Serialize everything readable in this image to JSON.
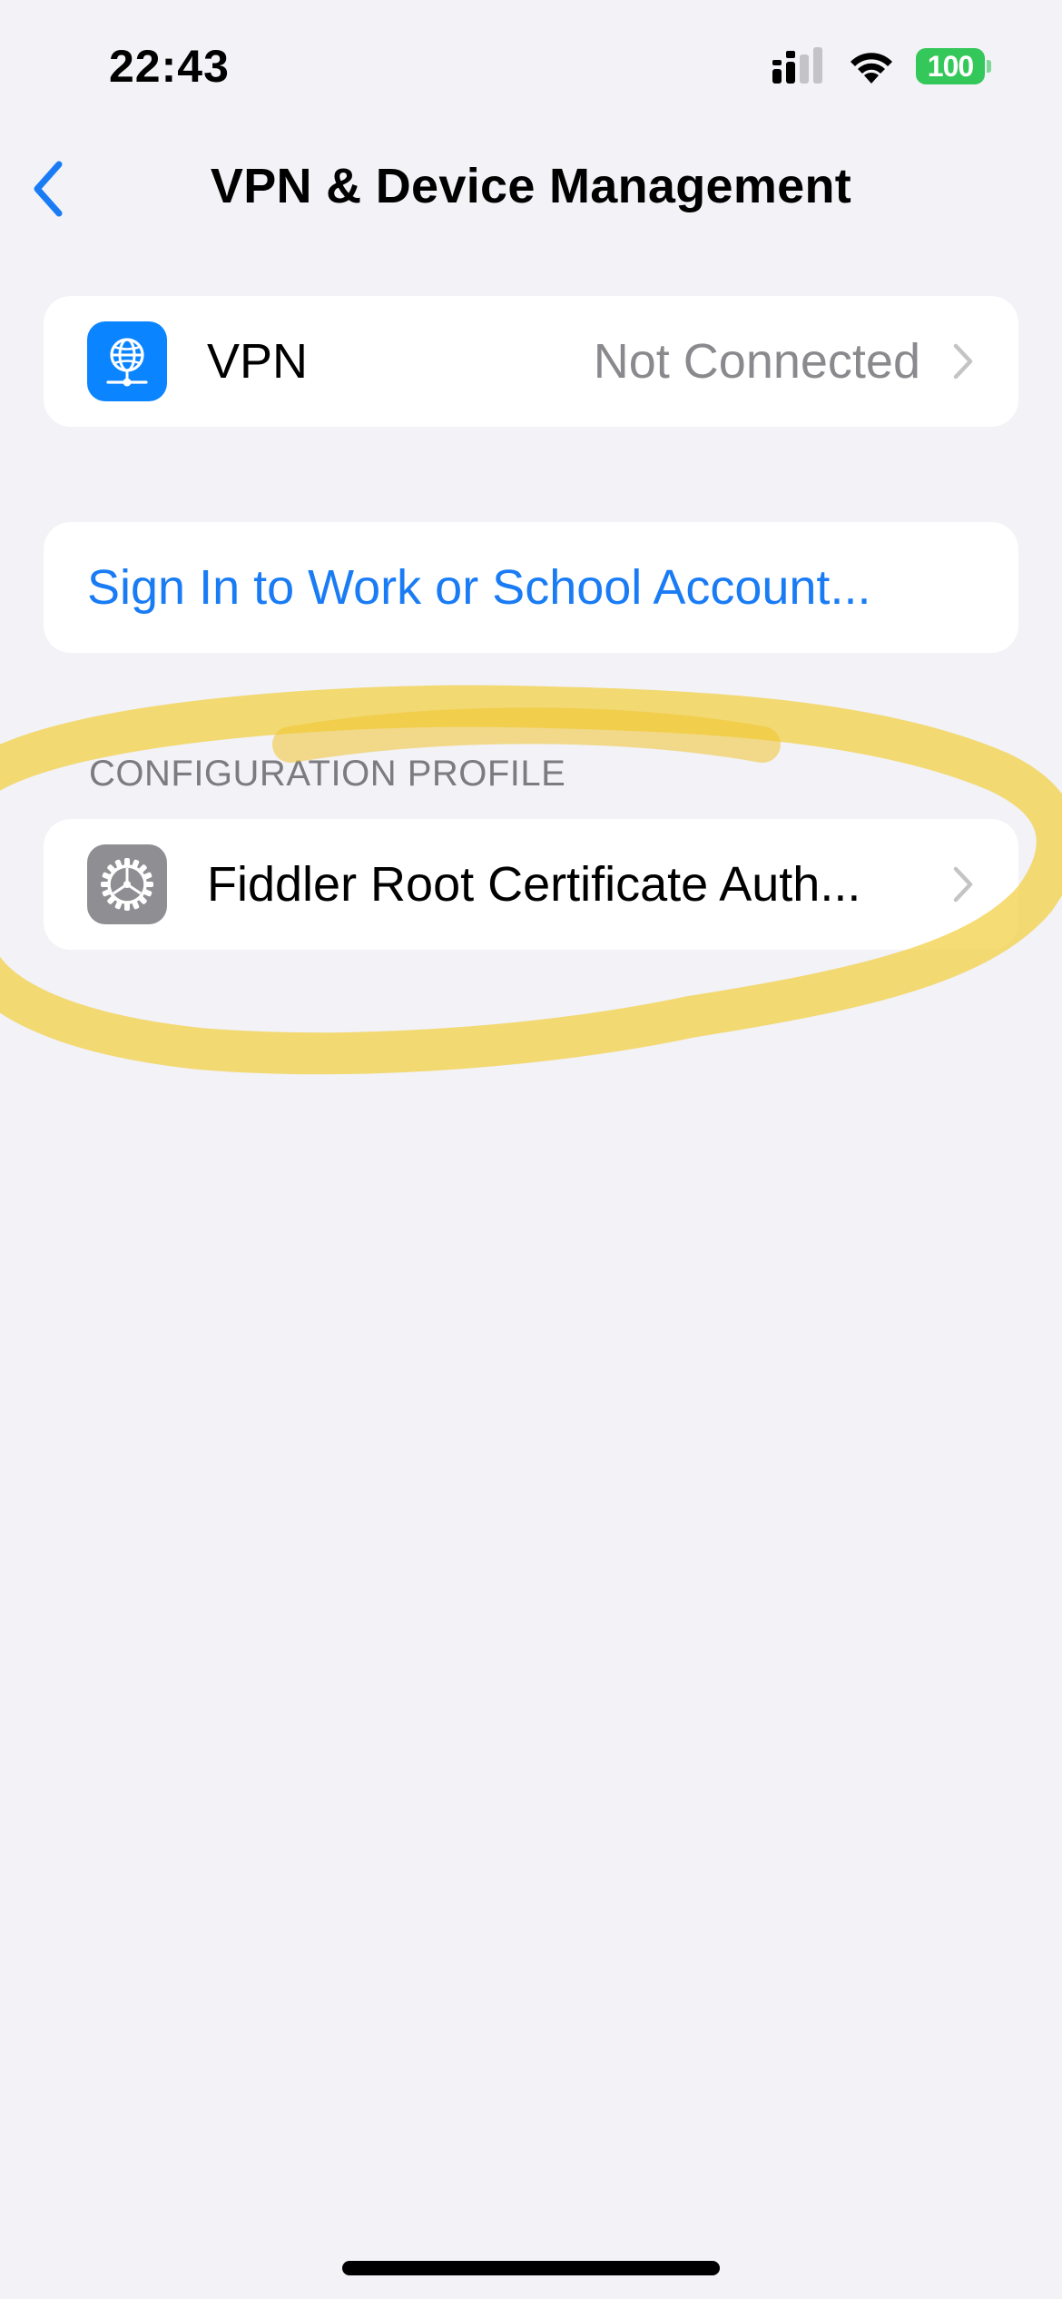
{
  "status_bar": {
    "time": "22:43",
    "battery": "100"
  },
  "nav": {
    "title": "VPN & Device Management",
    "back_icon": "chevron-left-icon"
  },
  "vpn_row": {
    "icon": "globe-network-icon",
    "label": "VPN",
    "value": "Not Connected"
  },
  "account_row": {
    "label": "Sign In to Work or School Account..."
  },
  "profiles": {
    "header": "CONFIGURATION PROFILE",
    "items": [
      {
        "icon": "gear-icon",
        "label": "Fiddler Root Certificate Auth..."
      }
    ]
  },
  "colors": {
    "accent": "#1a7cf5",
    "background": "#f2f2f7",
    "vpn_icon_bg": "#0a84ff",
    "profile_icon_bg": "#8e8e93",
    "battery": "#34c759",
    "highlight": "#f2cf3e"
  }
}
